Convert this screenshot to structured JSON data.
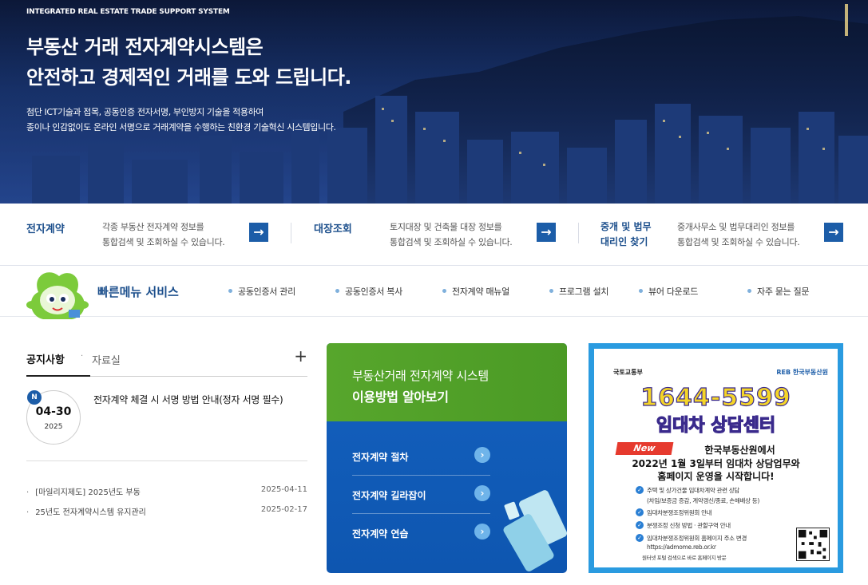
{
  "hero": {
    "eyebrow": "INTEGRATED REAL ESTATE TRADE SUPPORT SYSTEM",
    "title_line1": "부동산 거래 전자계약시스템은",
    "title_line2": "안전하고 경제적인 거래를 도와 드립니다.",
    "desc_line1": "첨단 ICT기술과 접목, 공동인증 전자서명, 부인방지 기술을 적용하여",
    "desc_line2": "종이나 인감없이도 온라인 서명으로 거래계약을 수행하는 친환경 기술혁신 시스템입니다."
  },
  "services": [
    {
      "title": "전자계약",
      "desc1": "각종 부동산 전자계약 정보를",
      "desc2": "통합검색 및 조회하실 수 있습니다.",
      "arrow": "→"
    },
    {
      "title": "대장조회",
      "desc1": "토지대장 및 건축물 대장 정보를",
      "desc2": "통합검색 및 조회하실 수 있습니다.",
      "arrow": "→"
    },
    {
      "title1": "중개 및 법무",
      "title2": "대리인 찾기",
      "desc1": "중개사무소 및 법무대리인 정보를",
      "desc2": "통합검색 및 조회하실 수 있습니다.",
      "arrow": "→"
    }
  ],
  "quick": {
    "title": "빠른메뉴 서비스",
    "links": [
      "공동인증서 관리",
      "공동인증서 복사",
      "전자계약 매뉴얼",
      "프로그램 설치",
      "뷰어 다운로드",
      "자주 묻는 질문"
    ]
  },
  "notice": {
    "tab_active": "공지사항",
    "tab_other": "자료실",
    "plus": "+",
    "featured": {
      "badge": "N",
      "date": "04-30",
      "year": "2025",
      "title": "전자계약 체결 시 서명 방법 안내(정자 서명 필수)"
    },
    "rows": [
      {
        "title": "[마일리지제도] 2025년도 부동",
        "date": "2025-04-11"
      },
      {
        "title": "25년도 전자계약시스템 유지관리",
        "date": "2025-02-17"
      }
    ]
  },
  "guide": {
    "subtitle": "부동산거래 전자계약 시스템",
    "title": "이용방법 알아보기",
    "items": [
      "전자계약 절차",
      "전자계약 길라잡이",
      "전자계약 연습"
    ],
    "arrow": "›"
  },
  "banner": {
    "org_left": "국토교통부",
    "org_right": "REB 한국부동산원",
    "phone": "1644-5599",
    "center": "임대차 상담센터",
    "new": "New",
    "head1": "한국부동산원에서",
    "head2": "2022년 1월 3일부터 임대차 상담업무와",
    "head3": "홈페이지 운영을 시작합니다!",
    "lines": [
      "주택 및 상가건물 임대차계약 관련 상담",
      "(차임/보증금 증감, 계약갱신/종료, 손해배상 등)",
      "임대차분쟁조정위원회 안내",
      "분쟁조정 신청 방법 · 관할구역 안내",
      "임대차분쟁조정위원회 홈페이지 주소 변경",
      "https://admome.reb.or.kr"
    ],
    "footer": "원터넷 포털 검색으로 바로 홈페이지 방문"
  },
  "colors": {
    "brand_blue": "#1c4f8c",
    "accent_blue": "#1c5da8",
    "green": "#57a62c",
    "banner_blue": "#2a9be0"
  }
}
